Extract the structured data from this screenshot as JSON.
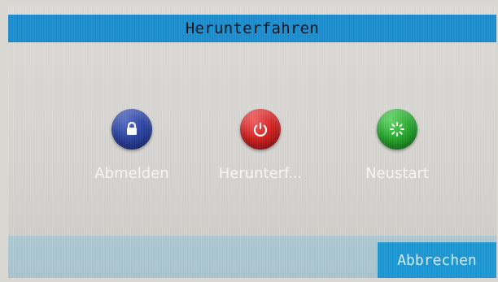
{
  "window": {
    "title": "Herunterfahren"
  },
  "actions": [
    {
      "label": "Abmelden",
      "icon": "lock-icon",
      "color": "#2d45a4"
    },
    {
      "label": "Herunterf...",
      "icon": "power-icon",
      "color": "#d31f1f"
    },
    {
      "label": "Neustart",
      "icon": "restart-icon",
      "color": "#25a72c"
    }
  ],
  "footer": {
    "cancel_label": "Abbrechen"
  },
  "colors": {
    "titlebar": "#1d8ed0",
    "panel_bg": "#dedcd8",
    "footer_bg": "#aecad4",
    "cancel_button_bg": "#1c97d4"
  }
}
